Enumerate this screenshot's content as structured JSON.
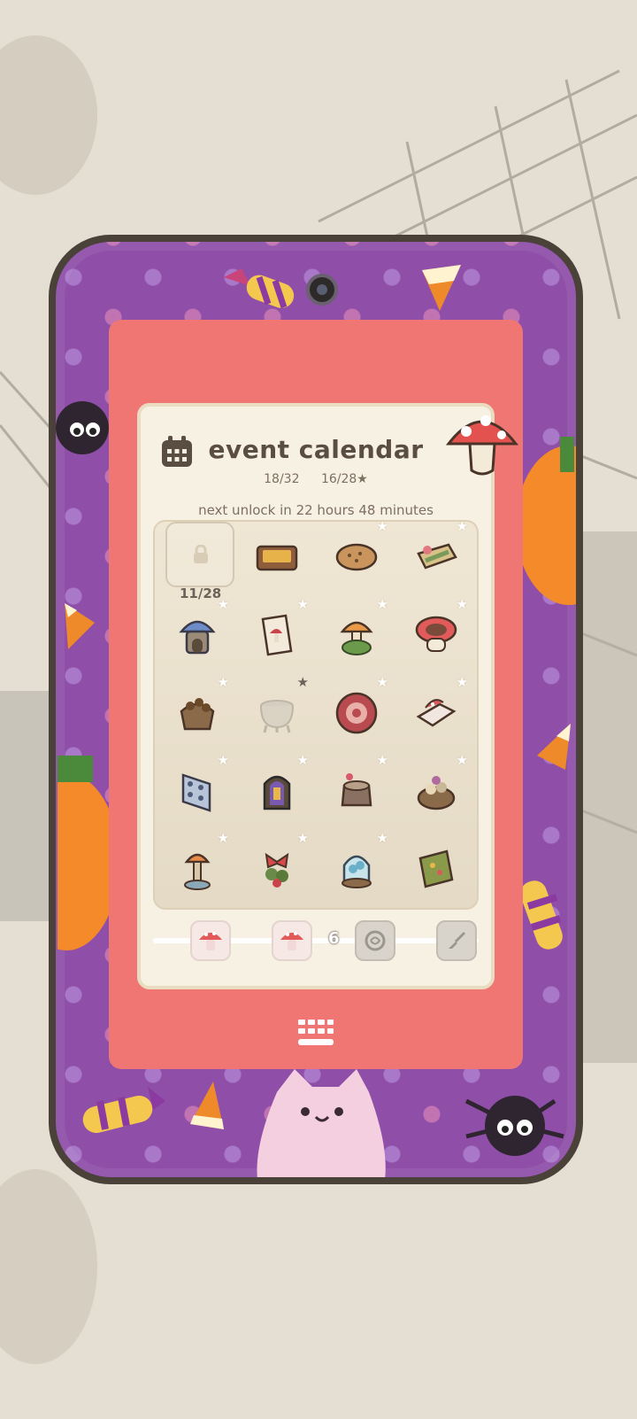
{
  "calendar": {
    "title": "event calendar",
    "progress_days": "18/32",
    "progress_stars": "16/28★",
    "unlock_text": "next unlock in 22 hours 48 minutes",
    "locked_count": "11/28"
  },
  "rewards": {
    "count": "6"
  },
  "items": [
    {
      "name": "locked-slot",
      "star": ""
    },
    {
      "name": "wooden-tray-icon",
      "star": ""
    },
    {
      "name": "round-table-icon",
      "star": "★"
    },
    {
      "name": "bed-icon",
      "star": "★"
    },
    {
      "name": "mushroom-house-icon",
      "star": "★"
    },
    {
      "name": "mushroom-card-icon",
      "star": "★"
    },
    {
      "name": "mushroom-lamp-icon",
      "star": "★"
    },
    {
      "name": "mushroom-stool-icon",
      "star": "★"
    },
    {
      "name": "acorn-bag-icon",
      "star": "★"
    },
    {
      "name": "cauldron-icon",
      "star": "★"
    },
    {
      "name": "mushroom-rug-icon",
      "star": "★"
    },
    {
      "name": "mushroom-sofa-icon",
      "star": "★"
    },
    {
      "name": "tile-panel-icon",
      "star": "★"
    },
    {
      "name": "stained-window-icon",
      "star": "★"
    },
    {
      "name": "tree-stump-icon",
      "star": "★"
    },
    {
      "name": "mushroom-basket-icon",
      "star": "★"
    },
    {
      "name": "mushroom-lantern-icon",
      "star": "★"
    },
    {
      "name": "bow-garland-icon",
      "star": "★"
    },
    {
      "name": "glass-dome-icon",
      "star": "★"
    },
    {
      "name": "scroll-rug-icon",
      "star": ""
    }
  ]
}
